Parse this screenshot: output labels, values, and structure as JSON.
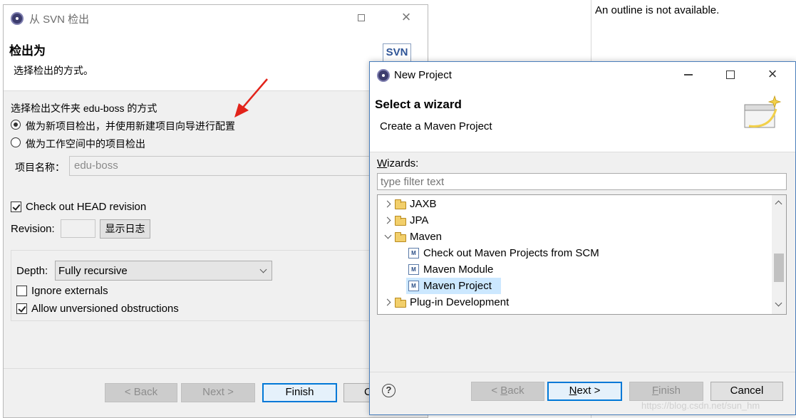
{
  "outline": {
    "message": "An outline is not available."
  },
  "svn_dialog": {
    "title": "从 SVN 检出",
    "heading": "检出为",
    "description": "选择检出的方式。",
    "badge": "SVN",
    "method_label": "选择检出文件夹 edu-boss 的方式",
    "option_new_project": "做为新项目检出，并使用新建项目向导进行配置",
    "option_workspace": "做为工作空间中的项目检出",
    "project_name_label": "项目名称：",
    "project_name_value": "edu-boss",
    "checkout_head_label": "Check out HEAD revision",
    "revision_label": "Revision:",
    "show_log_button": "显示日志",
    "depth_label": "Depth:",
    "depth_value": "Fully recursive",
    "ignore_externals_label": "Ignore externals",
    "allow_unversioned_label": "Allow unversioned obstructions",
    "back_button": "< Back",
    "next_button": "Next >",
    "finish_button": "Finish",
    "cancel_button": "C"
  },
  "new_project": {
    "title": "New Project",
    "heading": "Select a wizard",
    "description": "Create a Maven Project",
    "wizards_label": "Wizards:",
    "filter_placeholder": "type filter text",
    "tree": {
      "jaxb": "JAXB",
      "jpa": "JPA",
      "maven": "Maven",
      "checkout_maven": "Check out Maven Projects from SCM",
      "maven_module": "Maven Module",
      "maven_project": "Maven Project",
      "plugin_dev": "Plug-in Development"
    },
    "back_button": "< Back",
    "next_button": "Next >",
    "finish_button": "Finish",
    "cancel_button": "Cancel"
  },
  "watermark": "https://blog.csdn.net/sun_hm",
  "colors": {
    "selection": "#cce8ff",
    "arrow": "#e2231a",
    "default_border": "#0078d7"
  }
}
